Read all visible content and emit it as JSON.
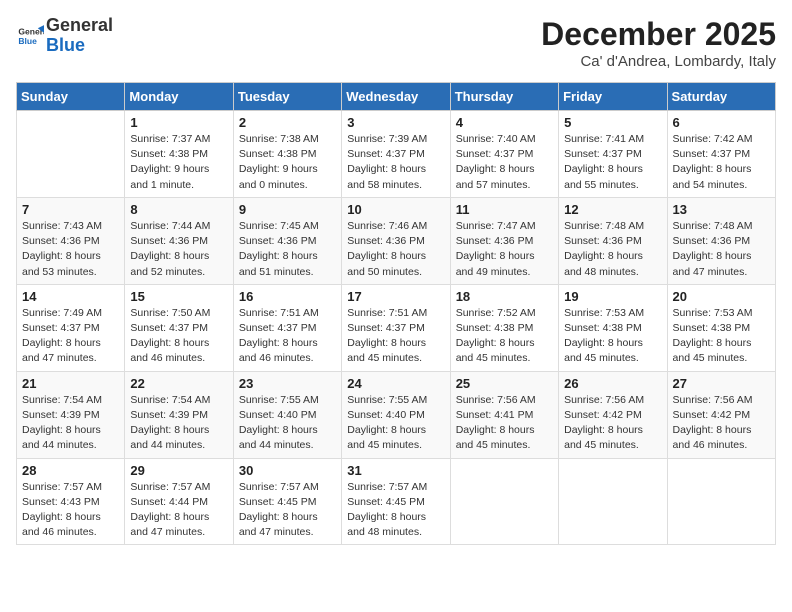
{
  "logo": {
    "general": "General",
    "blue": "Blue"
  },
  "header": {
    "month": "December 2025",
    "location": "Ca' d'Andrea, Lombardy, Italy"
  },
  "days_of_week": [
    "Sunday",
    "Monday",
    "Tuesday",
    "Wednesday",
    "Thursday",
    "Friday",
    "Saturday"
  ],
  "weeks": [
    [
      {
        "day": "",
        "info": ""
      },
      {
        "day": "1",
        "info": "Sunrise: 7:37 AM\nSunset: 4:38 PM\nDaylight: 9 hours\nand 1 minute."
      },
      {
        "day": "2",
        "info": "Sunrise: 7:38 AM\nSunset: 4:38 PM\nDaylight: 9 hours\nand 0 minutes."
      },
      {
        "day": "3",
        "info": "Sunrise: 7:39 AM\nSunset: 4:37 PM\nDaylight: 8 hours\nand 58 minutes."
      },
      {
        "day": "4",
        "info": "Sunrise: 7:40 AM\nSunset: 4:37 PM\nDaylight: 8 hours\nand 57 minutes."
      },
      {
        "day": "5",
        "info": "Sunrise: 7:41 AM\nSunset: 4:37 PM\nDaylight: 8 hours\nand 55 minutes."
      },
      {
        "day": "6",
        "info": "Sunrise: 7:42 AM\nSunset: 4:37 PM\nDaylight: 8 hours\nand 54 minutes."
      }
    ],
    [
      {
        "day": "7",
        "info": "Sunrise: 7:43 AM\nSunset: 4:36 PM\nDaylight: 8 hours\nand 53 minutes."
      },
      {
        "day": "8",
        "info": "Sunrise: 7:44 AM\nSunset: 4:36 PM\nDaylight: 8 hours\nand 52 minutes."
      },
      {
        "day": "9",
        "info": "Sunrise: 7:45 AM\nSunset: 4:36 PM\nDaylight: 8 hours\nand 51 minutes."
      },
      {
        "day": "10",
        "info": "Sunrise: 7:46 AM\nSunset: 4:36 PM\nDaylight: 8 hours\nand 50 minutes."
      },
      {
        "day": "11",
        "info": "Sunrise: 7:47 AM\nSunset: 4:36 PM\nDaylight: 8 hours\nand 49 minutes."
      },
      {
        "day": "12",
        "info": "Sunrise: 7:48 AM\nSunset: 4:36 PM\nDaylight: 8 hours\nand 48 minutes."
      },
      {
        "day": "13",
        "info": "Sunrise: 7:48 AM\nSunset: 4:36 PM\nDaylight: 8 hours\nand 47 minutes."
      }
    ],
    [
      {
        "day": "14",
        "info": "Sunrise: 7:49 AM\nSunset: 4:37 PM\nDaylight: 8 hours\nand 47 minutes."
      },
      {
        "day": "15",
        "info": "Sunrise: 7:50 AM\nSunset: 4:37 PM\nDaylight: 8 hours\nand 46 minutes."
      },
      {
        "day": "16",
        "info": "Sunrise: 7:51 AM\nSunset: 4:37 PM\nDaylight: 8 hours\nand 46 minutes."
      },
      {
        "day": "17",
        "info": "Sunrise: 7:51 AM\nSunset: 4:37 PM\nDaylight: 8 hours\nand 45 minutes."
      },
      {
        "day": "18",
        "info": "Sunrise: 7:52 AM\nSunset: 4:38 PM\nDaylight: 8 hours\nand 45 minutes."
      },
      {
        "day": "19",
        "info": "Sunrise: 7:53 AM\nSunset: 4:38 PM\nDaylight: 8 hours\nand 45 minutes."
      },
      {
        "day": "20",
        "info": "Sunrise: 7:53 AM\nSunset: 4:38 PM\nDaylight: 8 hours\nand 45 minutes."
      }
    ],
    [
      {
        "day": "21",
        "info": "Sunrise: 7:54 AM\nSunset: 4:39 PM\nDaylight: 8 hours\nand 44 minutes."
      },
      {
        "day": "22",
        "info": "Sunrise: 7:54 AM\nSunset: 4:39 PM\nDaylight: 8 hours\nand 44 minutes."
      },
      {
        "day": "23",
        "info": "Sunrise: 7:55 AM\nSunset: 4:40 PM\nDaylight: 8 hours\nand 44 minutes."
      },
      {
        "day": "24",
        "info": "Sunrise: 7:55 AM\nSunset: 4:40 PM\nDaylight: 8 hours\nand 45 minutes."
      },
      {
        "day": "25",
        "info": "Sunrise: 7:56 AM\nSunset: 4:41 PM\nDaylight: 8 hours\nand 45 minutes."
      },
      {
        "day": "26",
        "info": "Sunrise: 7:56 AM\nSunset: 4:42 PM\nDaylight: 8 hours\nand 45 minutes."
      },
      {
        "day": "27",
        "info": "Sunrise: 7:56 AM\nSunset: 4:42 PM\nDaylight: 8 hours\nand 46 minutes."
      }
    ],
    [
      {
        "day": "28",
        "info": "Sunrise: 7:57 AM\nSunset: 4:43 PM\nDaylight: 8 hours\nand 46 minutes."
      },
      {
        "day": "29",
        "info": "Sunrise: 7:57 AM\nSunset: 4:44 PM\nDaylight: 8 hours\nand 47 minutes."
      },
      {
        "day": "30",
        "info": "Sunrise: 7:57 AM\nSunset: 4:45 PM\nDaylight: 8 hours\nand 47 minutes."
      },
      {
        "day": "31",
        "info": "Sunrise: 7:57 AM\nSunset: 4:45 PM\nDaylight: 8 hours\nand 48 minutes."
      },
      {
        "day": "",
        "info": ""
      },
      {
        "day": "",
        "info": ""
      },
      {
        "day": "",
        "info": ""
      }
    ]
  ]
}
